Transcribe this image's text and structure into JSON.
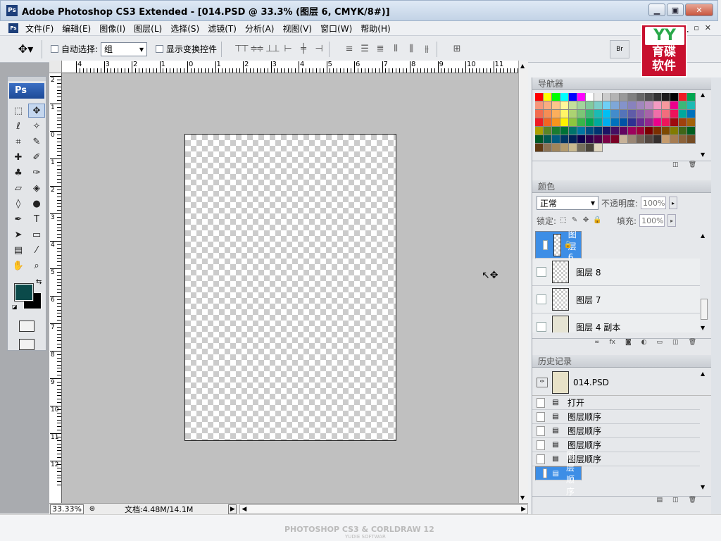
{
  "window": {
    "app_icon": "Ps",
    "title": "Adobe Photoshop CS3 Extended - [014.PSD @ 33.3% (图层 6, CMYK/8#)]",
    "minimize": "▁",
    "maximize": "▣",
    "close": "✕"
  },
  "menubar": {
    "items": [
      "文件(F)",
      "编辑(E)",
      "图像(I)",
      "图层(L)",
      "选择(S)",
      "滤镜(T)",
      "分析(A)",
      "视图(V)",
      "窗口(W)",
      "帮助(H)"
    ]
  },
  "options": {
    "auto_select_label": "自动选择:",
    "auto_select_value": "组",
    "show_transform_label": "显示变换控件",
    "bridge_icon": "bridge-icon"
  },
  "logo": {
    "top": "YY",
    "text": "育碟\n软件"
  },
  "rulers": {
    "h_labels": [
      "4",
      "3",
      "2",
      "1",
      "0",
      "1",
      "2",
      "3",
      "4",
      "5",
      "6",
      "7",
      "8",
      "9",
      "10",
      "11"
    ],
    "v_labels": [
      "2",
      "1",
      "0",
      "1",
      "2",
      "3",
      "4",
      "5",
      "6",
      "7",
      "8",
      "9",
      "10",
      "11",
      "12"
    ]
  },
  "status": {
    "zoom": "33.33%",
    "doc_info": "文档:4.48M/14.1M"
  },
  "navigator": {
    "title": "导航器",
    "swatches": [
      "#ff0000",
      "#ffff00",
      "#00ff00",
      "#00ffff",
      "#0000ff",
      "#ff00ff",
      "#ffffff",
      "#e6e6e6",
      "#cccccc",
      "#b3b3b3",
      "#999999",
      "#808080",
      "#666666",
      "#4d4d4d",
      "#333333",
      "#1a1a1a",
      "#000000",
      "#ee1c24",
      "#00a651",
      "#f7977a",
      "#f9ad81",
      "#fdc68a",
      "#fff79a",
      "#c4df9b",
      "#a2d39c",
      "#82ca9d",
      "#7bcdc8",
      "#6ecff6",
      "#7ea7d8",
      "#8493ca",
      "#8882be",
      "#a187be",
      "#bc8cbf",
      "#f49ac2",
      "#f6989d",
      "#ec008c",
      "#3cb878",
      "#1cbbb4",
      "#f26c4f",
      "#f68e55",
      "#fbaf5c",
      "#fff467",
      "#acd372",
      "#7cc576",
      "#3bb878",
      "#1abbb4",
      "#00bff3",
      "#438ccb",
      "#5574b9",
      "#605ca8",
      "#855fa8",
      "#a763a8",
      "#f06ea9",
      "#f26d7d",
      "#ed145b",
      "#00a99d",
      "#0072bc",
      "#ed1c24",
      "#f26522",
      "#f7941d",
      "#fff200",
      "#8dc63f",
      "#39b54a",
      "#00a651",
      "#00a99d",
      "#00aeef",
      "#0072bc",
      "#0054a6",
      "#2e3192",
      "#662d91",
      "#92278f",
      "#ec008c",
      "#ed145b",
      "#9e0b0f",
      "#a0410d",
      "#a3620a",
      "#aba000",
      "#598527",
      "#197b30",
      "#007236",
      "#00746b",
      "#0076a3",
      "#004b80",
      "#003471",
      "#1b1464",
      "#440e62",
      "#630460",
      "#9e005d",
      "#9e0039",
      "#790000",
      "#7b2e00",
      "#7d4900",
      "#827b00",
      "#406618",
      "#005e20",
      "#005826",
      "#005952",
      "#005b7f",
      "#003663",
      "#002157",
      "#0d004c",
      "#32004b",
      "#4b0049",
      "#7b0046",
      "#7a0026",
      "#c7b299",
      "#998675",
      "#736357",
      "#534741",
      "#362f2d",
      "#c69c6d",
      "#a67c52",
      "#8c6239",
      "#754c24",
      "#603913",
      "#8b7355",
      "#a0855b",
      "#b39b6e",
      "#c8b98f",
      "#756e5c",
      "#4a443a",
      "#e0d6c0"
    ]
  },
  "layers": {
    "title": "颜色",
    "blend_mode": "正常",
    "opacity_label": "不透明度:",
    "opacity_value": "100%",
    "lock_label": "锁定:",
    "fill_label": "填充:",
    "fill_value": "100%",
    "items": [
      {
        "name": "图层 6"
      },
      {
        "name": "图层 8"
      },
      {
        "name": "图层 7"
      },
      {
        "name": "图层 4 副本"
      }
    ]
  },
  "history": {
    "title": "历史记录",
    "snapshot": "014.PSD",
    "items": [
      "打开",
      "图层顺序",
      "图层顺序",
      "图层顺序",
      "图层顺序",
      "图层顺序"
    ]
  },
  "watermark": {
    "main": "PHOTOSHOP CS3 & CORLDRAW 12",
    "sub": "YUDIE SOFTWAR"
  }
}
